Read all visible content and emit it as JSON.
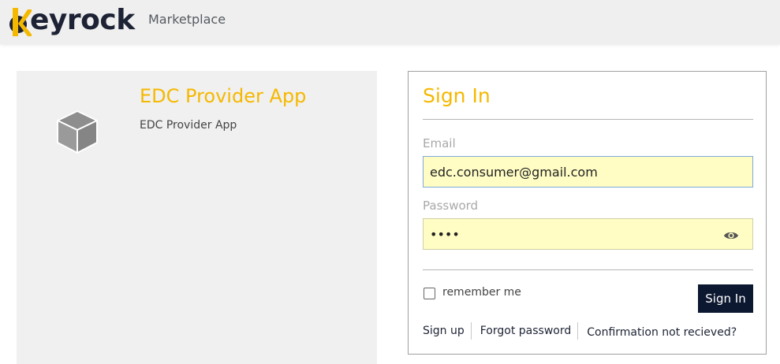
{
  "header": {
    "logo_text": "eyrock",
    "logo_letter": "K",
    "brand_colors": {
      "primary": "#f5b800",
      "dark": "#1d2335"
    },
    "subtitle": "Marketplace"
  },
  "application": {
    "icon": "cube-icon",
    "name": "EDC Provider App",
    "description": "EDC Provider App"
  },
  "signin": {
    "title": "Sign In",
    "email_label": "Email",
    "email_value": "edc.consumer@gmail.com",
    "password_label": "Password",
    "password_value": "••••",
    "show_password_icon": "eye-icon",
    "remember_label": "remember me",
    "remember_checked": false,
    "button_label": "Sign In",
    "links": {
      "signup": "Sign up",
      "forgot": "Forgot password",
      "confirmation": "Confirmation not recieved?"
    }
  },
  "colors": {
    "accent": "#f5b800",
    "button_bg": "#0c1730",
    "input_bg": "#fffdc4",
    "panel_bg": "#f0f0f0"
  }
}
